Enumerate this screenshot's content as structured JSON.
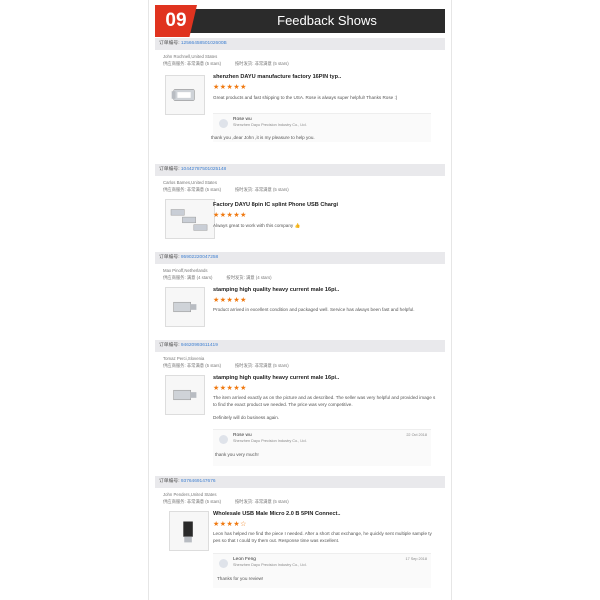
{
  "header": {
    "number": "09",
    "title": "Feedback Shows"
  },
  "orders": [
    {
      "order_label": "订单编号:",
      "order_id": "1256645850102600B",
      "buyer": "John Rochnell,United States",
      "rating_a": "供应商服务: 非常满意   (5 stars)",
      "rating_b": "按时发货: 非常满意   (5 stars)",
      "product_title": "shenzhen DAYU manufacture factory 16PIN typ..",
      "stars": "★★★★★",
      "review": "Great products and fast shipping to the USA. Rose is always super helpful! Thanks Rose :)",
      "reply": {
        "name": "Rose wu",
        "company": "Shenzhen Dayu Precision Industry Co., Ltd.",
        "date": "",
        "text": "thank you ,dear John ,it is my pleasure to help you."
      }
    },
    {
      "order_label": "订单编号:",
      "order_id": "10442787501025148",
      "buyer": "Carlos Bames,United States",
      "rating_a": "供应商服务: 非常满意   (5 stars)",
      "rating_b": "按时发货: 非常满意   (5 stars)",
      "product_title": "Factory DAYU 8pin IC splint Phone USB Chargi",
      "stars": "★★★★★",
      "review": "Always great to work with this company 👍"
    },
    {
      "order_label": "订单编号:",
      "order_id": "95902220047258",
      "buyer": "Max Pinoff,Netherlands",
      "rating_a": "供应商服务: 满意   (4 stars)",
      "rating_b": "按时发货: 满意   (4 stars)",
      "product_title": "stamping high quality heavy current male 16pi..",
      "stars": "★★★★★",
      "review": "Product arrived in excellent condition and packaged well. Service has always been fast and helpful."
    },
    {
      "order_label": "订单编号:",
      "order_id": "94620993611419",
      "buyer": "Tomaz Perci,Slovenia",
      "rating_a": "供应商服务: 非常满意   (5 stars)",
      "rating_b": "按时发货: 非常满意   (5 stars)",
      "product_title": "stamping high quality heavy current male 16pi..",
      "stars": "★★★★★",
      "review": "The item arrived exactly as on the picture and as described. The seller was very helpful and provided image s to find the exact product we needed. The price was very competitive.",
      "review2": "Definitely will do business again.",
      "reply": {
        "name": "Rose wu",
        "company": "Shenzhen Dayu Precision Industry Co., Ltd.",
        "date": "22 Oct 2018",
        "text": "thank you very much!"
      }
    },
    {
      "order_label": "订单编号:",
      "order_id": "9376469147676",
      "buyer": "John Penders,United States",
      "rating_a": "供应商服务: 非常满意   (5 stars)",
      "rating_b": "按时发货: 非常满意   (5 stars)",
      "product_title": "Wholesale USB Male Micro 2.0 B 5PIN Connect..",
      "stars": "★★★★☆",
      "review": "Leon has helped me find the piece I needed. After a short chat exchange, he quickly sent multiple sample ty pes so that I could try them out. Response time was excellent.",
      "reply": {
        "name": "Leon Feng",
        "company": "Shenzhen Dayu Precision Industry Co., Ltd.",
        "date": "17 Sep 2018",
        "text": "Thanks for you review!"
      }
    }
  ]
}
